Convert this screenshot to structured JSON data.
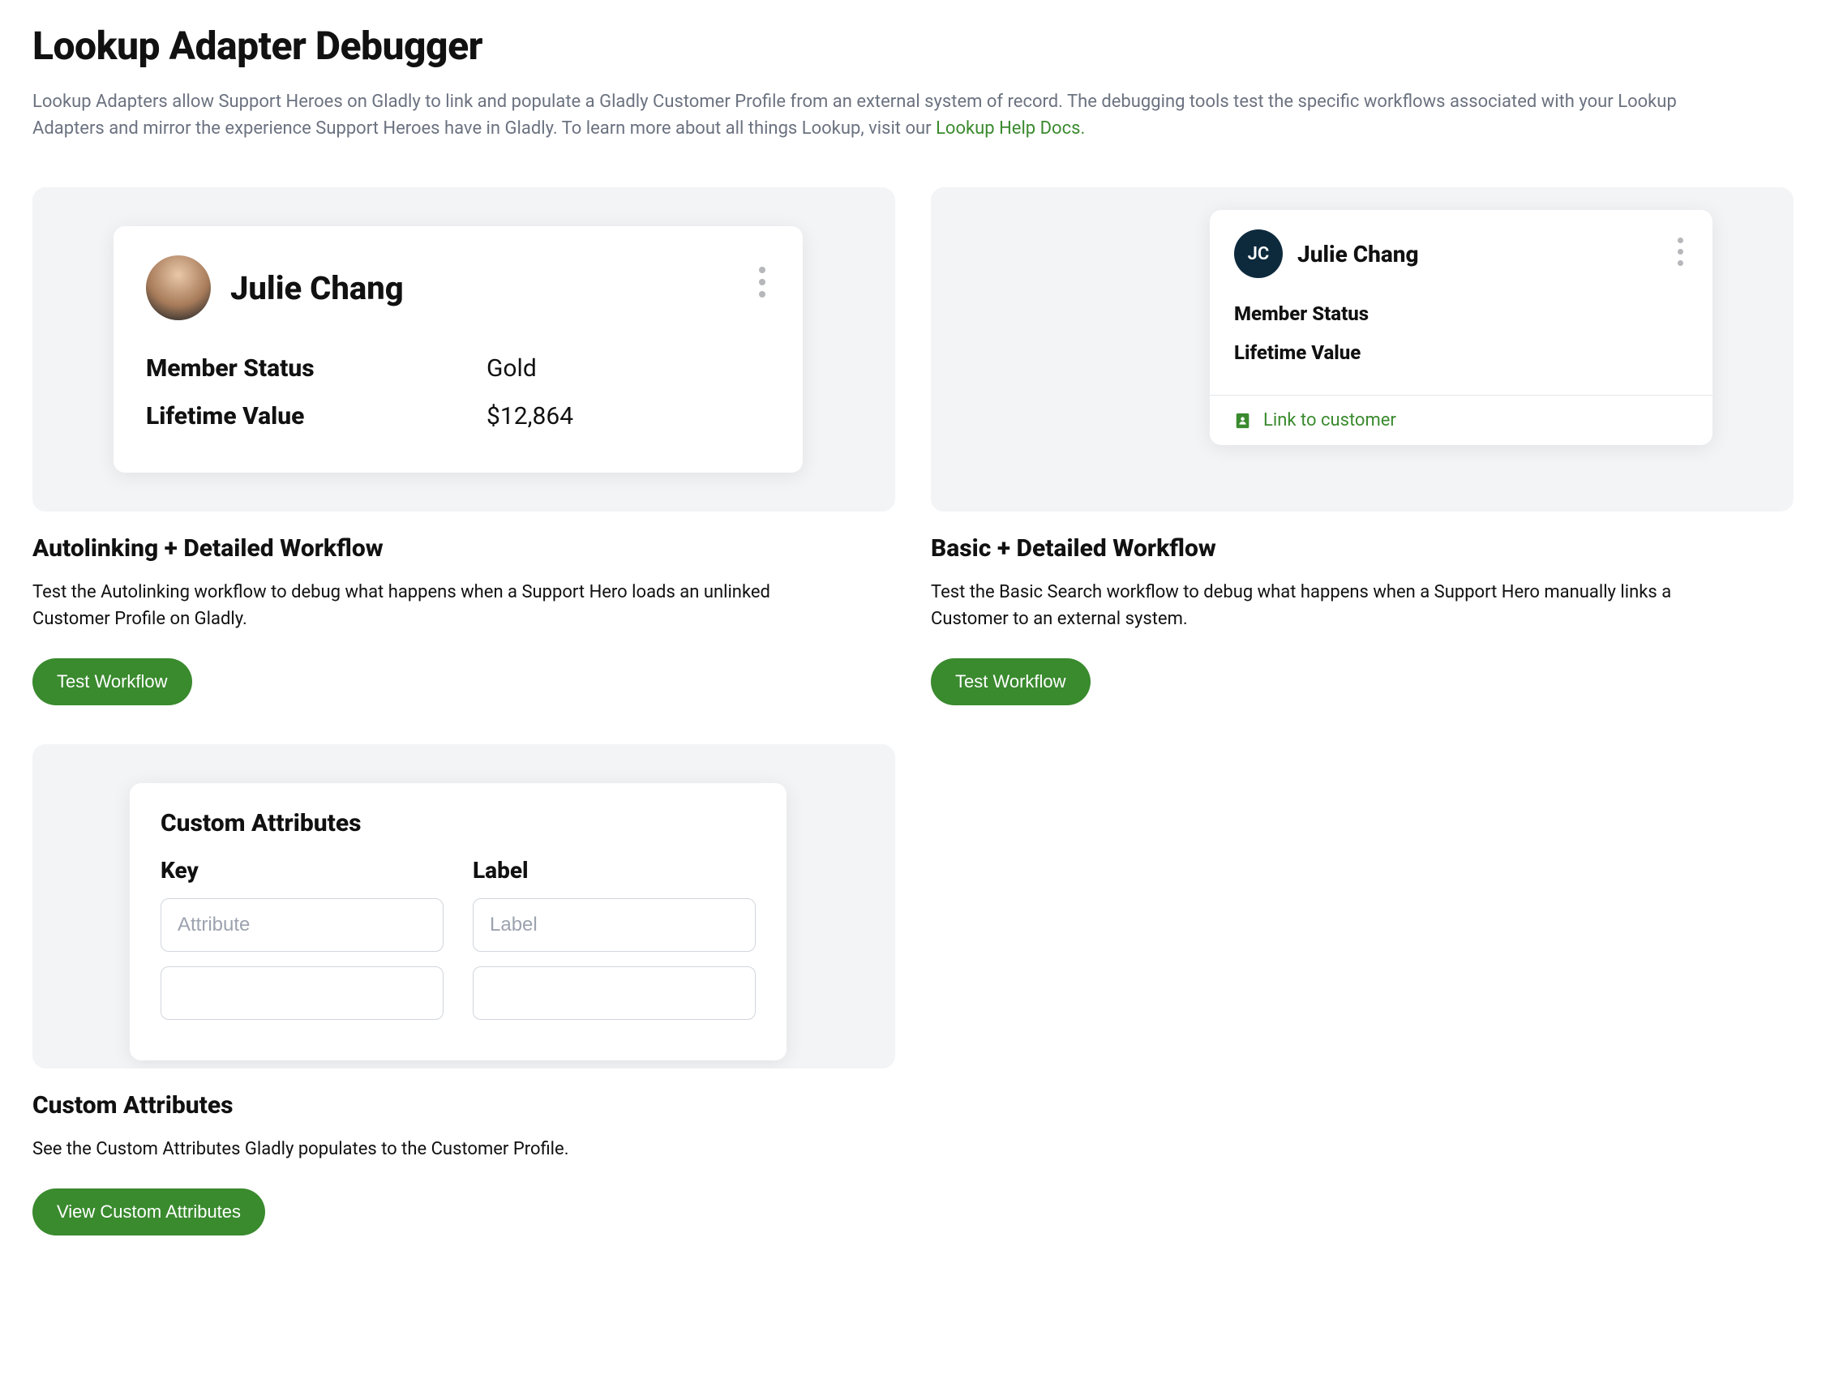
{
  "page": {
    "title": "Lookup Adapter Debugger",
    "intro": "Lookup Adapters allow Support Heroes on Gladly to link and populate a Gladly Customer Profile from an external system of record. The debugging tools test the specific workflows associated with your Lookup Adapters and mirror the experience Support Heroes have in Gladly. To learn more about all things Lookup, visit our ",
    "intro_link_label": "Lookup Help Docs."
  },
  "cards": {
    "autolinking": {
      "title": "Autolinking + Detailed Workflow",
      "desc": "Test the Autolinking workflow to debug what happens when a Support Hero loads an unlinked Customer Profile on Gladly.",
      "button": "Test Workflow",
      "preview": {
        "name": "Julie Chang",
        "rows": [
          {
            "key": "Member Status",
            "value": "Gold"
          },
          {
            "key": "Lifetime Value",
            "value": "$12,864"
          }
        ]
      }
    },
    "basic": {
      "title": "Basic + Detailed Workflow",
      "desc": "Test the Basic Search workflow to debug what happens when a Support Hero manually links a Customer to an external system.",
      "button": "Test Workflow",
      "preview": {
        "initials": "JC",
        "name": "Julie Chang",
        "attrs": [
          "Member Status",
          "Lifetime Value"
        ],
        "link_label": "Link to customer"
      }
    },
    "custom_attrs": {
      "title": "Custom Attributes",
      "desc": "See the Custom Attributes Gladly populates to the Customer Profile.",
      "button": "View Custom Attributes",
      "preview": {
        "panel_title": "Custom Attributes",
        "key_header": "Key",
        "label_header": "Label",
        "key_placeholder": "Attribute",
        "label_placeholder": "Label"
      }
    }
  }
}
